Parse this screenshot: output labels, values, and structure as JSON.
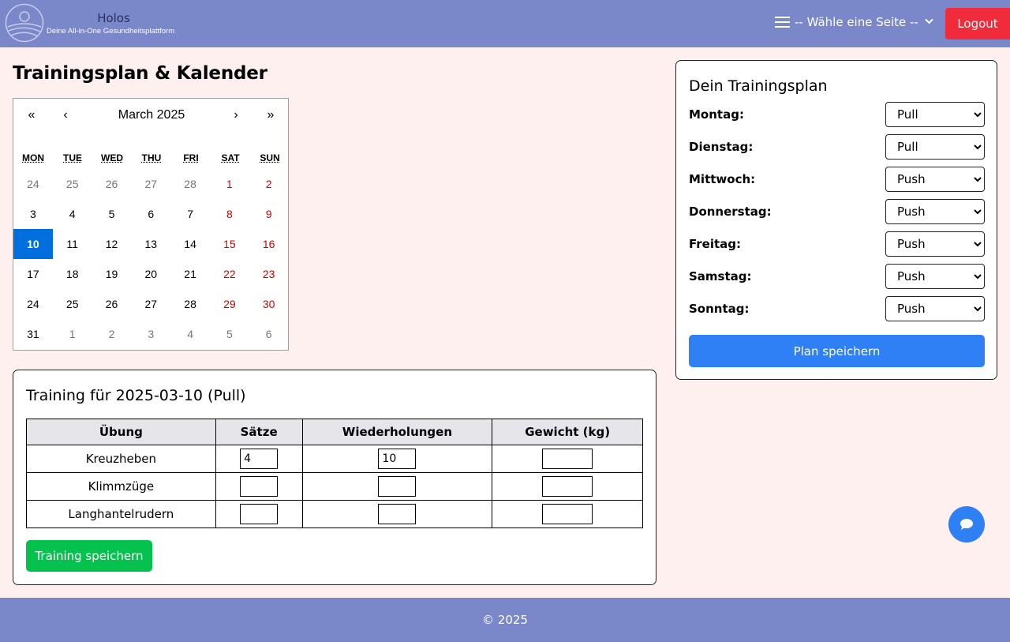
{
  "header": {
    "brand_name": "Holos",
    "brand_tagline": "Deine All-in-One Gesundheitsplattform",
    "nav_select": "-- Wähle eine Seite --",
    "logout_label": "Logout"
  },
  "page_title": "Trainingsplan & Kalender",
  "calendar": {
    "nav": {
      "prev2": "«",
      "prev": "‹",
      "next": "›",
      "next2": "»"
    },
    "month_label": "March 2025",
    "weekdays": [
      "MON",
      "TUE",
      "WED",
      "THU",
      "FRI",
      "SAT",
      "SUN"
    ],
    "days": [
      {
        "n": "24",
        "t": "other"
      },
      {
        "n": "25",
        "t": "other"
      },
      {
        "n": "26",
        "t": "other"
      },
      {
        "n": "27",
        "t": "other"
      },
      {
        "n": "28",
        "t": "other"
      },
      {
        "n": "1",
        "t": "weekend"
      },
      {
        "n": "2",
        "t": "weekend"
      },
      {
        "n": "3",
        "t": ""
      },
      {
        "n": "4",
        "t": ""
      },
      {
        "n": "5",
        "t": ""
      },
      {
        "n": "6",
        "t": ""
      },
      {
        "n": "7",
        "t": ""
      },
      {
        "n": "8",
        "t": "weekend"
      },
      {
        "n": "9",
        "t": "weekend"
      },
      {
        "n": "10",
        "t": "sel"
      },
      {
        "n": "11",
        "t": ""
      },
      {
        "n": "12",
        "t": ""
      },
      {
        "n": "13",
        "t": ""
      },
      {
        "n": "14",
        "t": ""
      },
      {
        "n": "15",
        "t": "weekend"
      },
      {
        "n": "16",
        "t": "weekend"
      },
      {
        "n": "17",
        "t": ""
      },
      {
        "n": "18",
        "t": ""
      },
      {
        "n": "19",
        "t": ""
      },
      {
        "n": "20",
        "t": ""
      },
      {
        "n": "21",
        "t": ""
      },
      {
        "n": "22",
        "t": "weekend"
      },
      {
        "n": "23",
        "t": "weekend"
      },
      {
        "n": "24",
        "t": ""
      },
      {
        "n": "25",
        "t": ""
      },
      {
        "n": "26",
        "t": ""
      },
      {
        "n": "27",
        "t": ""
      },
      {
        "n": "28",
        "t": ""
      },
      {
        "n": "29",
        "t": "weekend"
      },
      {
        "n": "30",
        "t": "weekend"
      },
      {
        "n": "31",
        "t": ""
      },
      {
        "n": "1",
        "t": "other"
      },
      {
        "n": "2",
        "t": "other"
      },
      {
        "n": "3",
        "t": "other"
      },
      {
        "n": "4",
        "t": "other"
      },
      {
        "n": "5",
        "t": "other"
      },
      {
        "n": "6",
        "t": "other"
      }
    ]
  },
  "plan": {
    "title": "Dein Trainingsplan",
    "days": [
      {
        "label": "Montag:",
        "value": "Pull"
      },
      {
        "label": "Dienstag:",
        "value": "Pull"
      },
      {
        "label": "Mittwoch:",
        "value": "Push"
      },
      {
        "label": "Donnerstag:",
        "value": "Push"
      },
      {
        "label": "Freitag:",
        "value": "Push"
      },
      {
        "label": "Samstag:",
        "value": "Push"
      },
      {
        "label": "Sonntag:",
        "value": "Push"
      }
    ],
    "save_label": "Plan speichern"
  },
  "training": {
    "title": "Training für 2025-03-10 (Pull)",
    "columns": [
      "Übung",
      "Sätze",
      "Wiederholungen",
      "Gewicht (kg)"
    ],
    "rows": [
      {
        "exercise": "Kreuzheben",
        "sets": "4",
        "reps": "10",
        "weight": ""
      },
      {
        "exercise": "Klimmzüge",
        "sets": "",
        "reps": "",
        "weight": ""
      },
      {
        "exercise": "Langhantelrudern",
        "sets": "",
        "reps": "",
        "weight": ""
      }
    ],
    "save_label": "Training speichern"
  },
  "footer": {
    "copyright": "© 2025"
  },
  "icons": {
    "logo": "sun-landscape-logo",
    "menu": "hamburger-icon",
    "chat": "chat-bubble-icon"
  },
  "colors": {
    "header_bg": "#7a87c9",
    "page_bg": "#fdf0ef",
    "logout": "#f02c3c",
    "primary": "#2f7ff5",
    "success": "#05c24e",
    "selected_day": "#006edc",
    "weekend": "#d10000"
  }
}
